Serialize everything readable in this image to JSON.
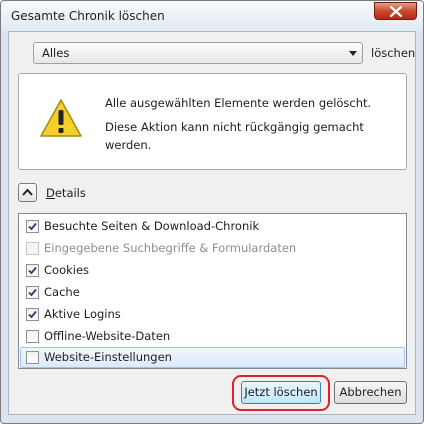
{
  "window": {
    "title": "Gesamte Chronik löschen"
  },
  "range": {
    "selected": "Alles",
    "caption": "löschen"
  },
  "warning": {
    "line1": "Alle ausgewählten Elemente werden gelöscht.",
    "line2": "Diese Aktion kann nicht rückgängig gemacht werden."
  },
  "details": {
    "label_first": "D",
    "label_rest": "etails",
    "expanded": true
  },
  "items": [
    {
      "label": "Besuchte Seiten & Download-Chronik",
      "checked": true,
      "disabled": false
    },
    {
      "label": "Eingegebene Suchbegriffe & Formulardaten",
      "checked": false,
      "disabled": true
    },
    {
      "label": "Cookies",
      "checked": true,
      "disabled": false
    },
    {
      "label": "Cache",
      "checked": true,
      "disabled": false
    },
    {
      "label": "Aktive Logins",
      "checked": true,
      "disabled": false
    },
    {
      "label": "Offline-Website-Daten",
      "checked": false,
      "disabled": false
    },
    {
      "label": "Website-Einstellungen",
      "checked": false,
      "disabled": false,
      "selected": true
    }
  ],
  "buttons": {
    "confirm": "Jetzt löschen",
    "cancel": "Abbrechen"
  },
  "colors": {
    "highlight_ring": "#e0202a",
    "close_button": "#c8452c",
    "warning_yellow": "#f5cf2a"
  }
}
